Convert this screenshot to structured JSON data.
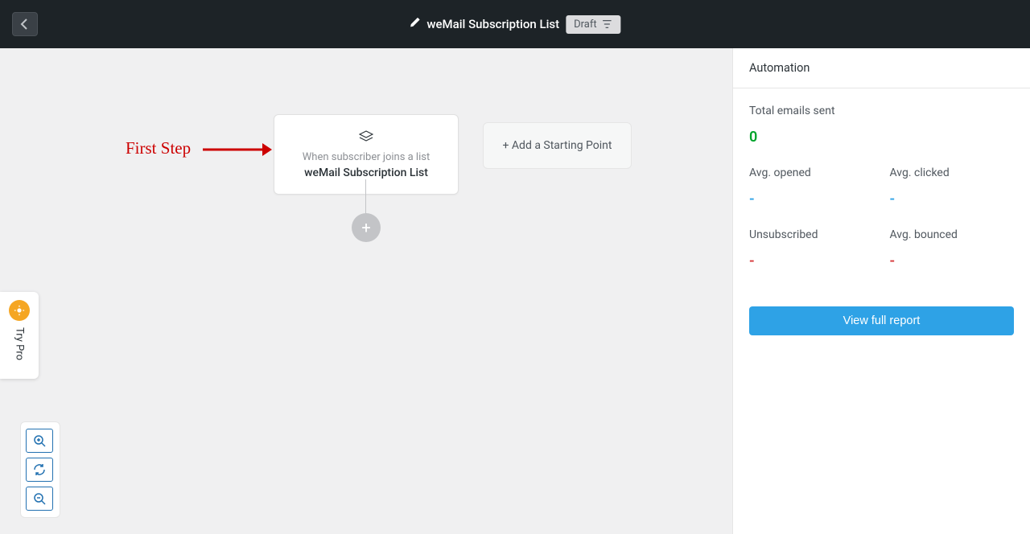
{
  "header": {
    "title": "weMail Subscription List",
    "status_badge": "Draft"
  },
  "annotation": {
    "label": "First Step"
  },
  "trigger": {
    "subtitle": "When subscriber joins a list",
    "name": "weMail Subscription List"
  },
  "add_start": {
    "label": "+ Add a Starting Point"
  },
  "try_pro": {
    "label": "Try Pro"
  },
  "sidebar": {
    "title": "Automation",
    "stats": {
      "total_sent": {
        "label": "Total emails sent",
        "value": "0"
      },
      "avg_opened": {
        "label": "Avg. opened",
        "value": "-"
      },
      "avg_clicked": {
        "label": "Avg. clicked",
        "value": "-"
      },
      "unsubscribed": {
        "label": "Unsubscribed",
        "value": "-"
      },
      "avg_bounced": {
        "label": "Avg. bounced",
        "value": "-"
      }
    },
    "report_btn": "View full report"
  }
}
